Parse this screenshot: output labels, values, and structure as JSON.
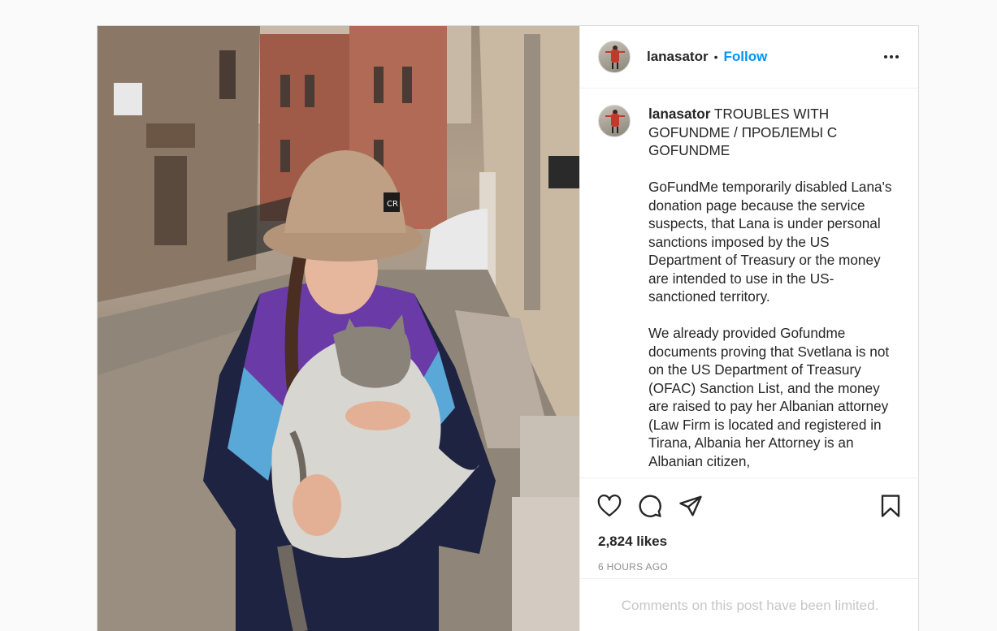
{
  "post": {
    "username": "lanasator",
    "follow_label": "Follow",
    "separator": "•",
    "caption": {
      "title": "TROUBLES WITH GOFUNDME / ПРОБЛЕМЫ С GOFUNDME",
      "paragraph_1": "GoFundMe temporarily disabled Lana's donation page because the service suspects, that Lana is under personal sanctions imposed by the US Department of Treasury or the money are intended to use in the US-sanctioned territory.",
      "paragraph_2": "We already provided Gofundme documents proving that Svetlana is not on the US Department of Treasury (OFAC) Sanction List, and the money are raised to pay her Albanian attorney (Law Firm is located and registered in Tirana, Albania her Attorney is an Albanian citizen,"
    },
    "likes": "2,824 likes",
    "timestamp": "6 HOURS AGO",
    "comments_notice": "Comments on this post have been limited.",
    "icons": {
      "more": "more-options-icon",
      "like": "heart-icon",
      "comment": "comment-icon",
      "share": "share-icon",
      "save": "bookmark-icon"
    },
    "colors": {
      "accent": "#0095f6",
      "text": "#262626",
      "muted": "#8e8e8e",
      "border": "#dbdbdb"
    },
    "hat_badge": "CR"
  }
}
